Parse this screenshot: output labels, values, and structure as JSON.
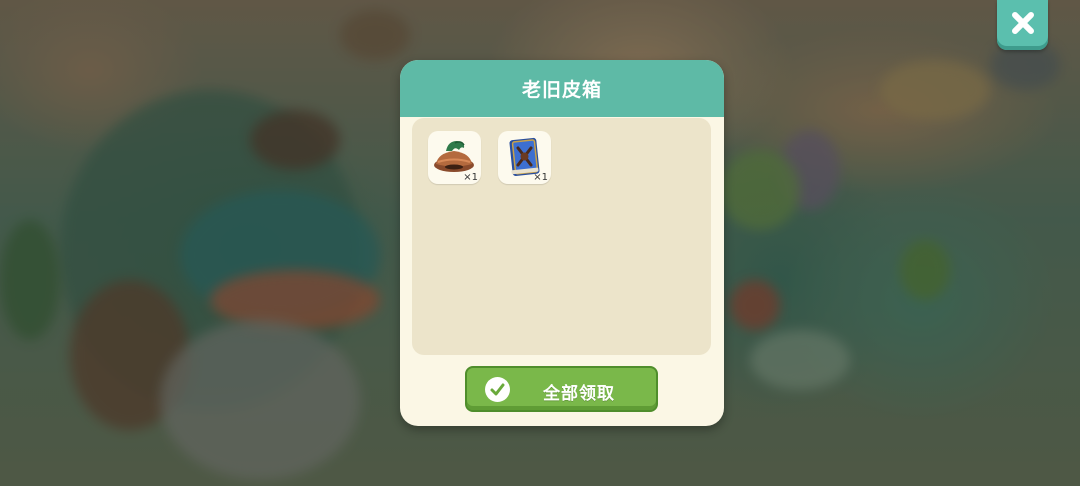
{
  "dialog": {
    "title": "老旧皮箱",
    "items": [
      {
        "icon": "hat-icon",
        "count": "×1"
      },
      {
        "icon": "spellbook-icon",
        "count": "×1"
      }
    ],
    "claim_all_label": "全部领取"
  },
  "colors": {
    "header": "#5ebaa6",
    "dialog_bg": "#fbf7e5",
    "body_bg": "#ece4ca",
    "claim_button": "#7ab84a",
    "close_button": "#5bbfae"
  }
}
